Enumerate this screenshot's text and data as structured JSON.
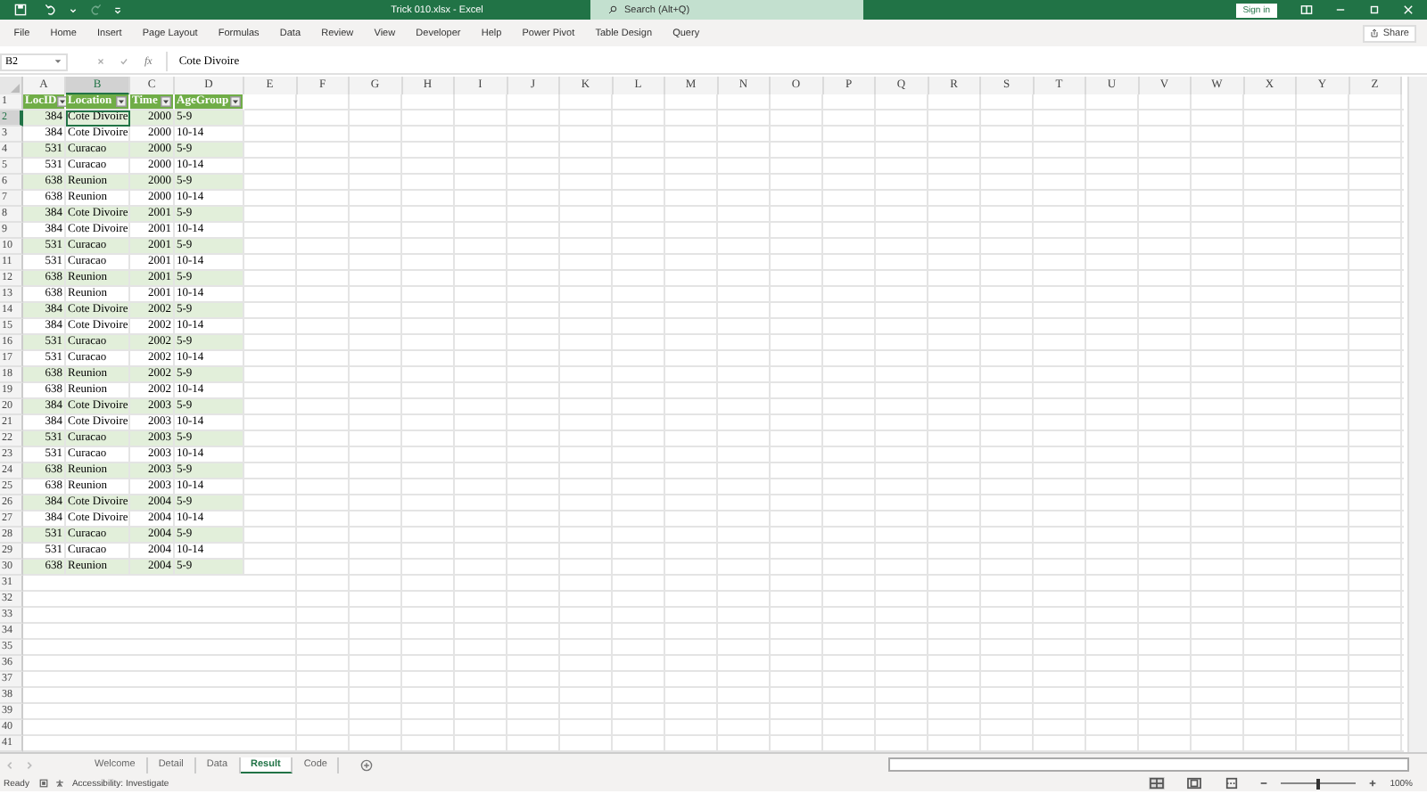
{
  "window": {
    "title": "Trick 010.xlsx  -  Excel",
    "search": {
      "placeholder": "Search (Alt+Q)"
    },
    "sign_in": "Sign in"
  },
  "ribbon": {
    "tabs": [
      "File",
      "Home",
      "Insert",
      "Page Layout",
      "Formulas",
      "Data",
      "Review",
      "View",
      "Developer",
      "Help",
      "Power Pivot",
      "Table Design",
      "Query"
    ],
    "share": "Share"
  },
  "formula_bar": {
    "name_box": "B2",
    "fx_label": "fx",
    "value": "Cote Divoire"
  },
  "grid": {
    "column_letters": [
      {
        "label": "A",
        "selected": false
      },
      {
        "label": "B",
        "selected": true
      },
      {
        "label": "C",
        "selected": false
      },
      {
        "label": "D",
        "selected": false
      },
      {
        "label": "E",
        "selected": false
      },
      {
        "label": "F",
        "selected": false
      },
      {
        "label": "G",
        "selected": false
      },
      {
        "label": "H",
        "selected": false
      },
      {
        "label": "I",
        "selected": false
      },
      {
        "label": "J",
        "selected": false
      },
      {
        "label": "K",
        "selected": false
      },
      {
        "label": "L",
        "selected": false
      },
      {
        "label": "M",
        "selected": false
      },
      {
        "label": "N",
        "selected": false
      },
      {
        "label": "O",
        "selected": false
      },
      {
        "label": "P",
        "selected": false
      },
      {
        "label": "Q",
        "selected": false
      },
      {
        "label": "R",
        "selected": false
      },
      {
        "label": "S",
        "selected": false
      },
      {
        "label": "T",
        "selected": false
      },
      {
        "label": "U",
        "selected": false
      },
      {
        "label": "V",
        "selected": false
      },
      {
        "label": "W",
        "selected": false
      },
      {
        "label": "X",
        "selected": false
      },
      {
        "label": "Y",
        "selected": false
      },
      {
        "label": "Z",
        "selected": false
      }
    ],
    "row_numbers": [
      {
        "label": "1",
        "selected": false
      },
      {
        "label": "2",
        "selected": true
      },
      {
        "label": "3",
        "selected": false
      },
      {
        "label": "4",
        "selected": false
      },
      {
        "label": "5",
        "selected": false
      },
      {
        "label": "6",
        "selected": false
      },
      {
        "label": "7",
        "selected": false
      },
      {
        "label": "8",
        "selected": false
      },
      {
        "label": "9",
        "selected": false
      },
      {
        "label": "10",
        "selected": false
      },
      {
        "label": "11",
        "selected": false
      },
      {
        "label": "12",
        "selected": false
      },
      {
        "label": "13",
        "selected": false
      },
      {
        "label": "14",
        "selected": false
      },
      {
        "label": "15",
        "selected": false
      },
      {
        "label": "16",
        "selected": false
      },
      {
        "label": "17",
        "selected": false
      },
      {
        "label": "18",
        "selected": false
      },
      {
        "label": "19",
        "selected": false
      },
      {
        "label": "20",
        "selected": false
      },
      {
        "label": "21",
        "selected": false
      },
      {
        "label": "22",
        "selected": false
      },
      {
        "label": "23",
        "selected": false
      },
      {
        "label": "24",
        "selected": false
      },
      {
        "label": "25",
        "selected": false
      },
      {
        "label": "26",
        "selected": false
      },
      {
        "label": "27",
        "selected": false
      },
      {
        "label": "28",
        "selected": false
      },
      {
        "label": "29",
        "selected": false
      },
      {
        "label": "30",
        "selected": false
      },
      {
        "label": "31",
        "selected": false
      },
      {
        "label": "32",
        "selected": false
      },
      {
        "label": "33",
        "selected": false
      },
      {
        "label": "34",
        "selected": false
      },
      {
        "label": "35",
        "selected": false
      },
      {
        "label": "36",
        "selected": false
      },
      {
        "label": "37",
        "selected": false
      },
      {
        "label": "38",
        "selected": false
      },
      {
        "label": "39",
        "selected": false
      },
      {
        "label": "40",
        "selected": false
      },
      {
        "label": "41",
        "selected": false
      }
    ]
  },
  "table": {
    "columns": [
      "LocID",
      "Location",
      "Time",
      "AgeGroup"
    ],
    "rows": [
      [
        "384",
        "Cote Divoire",
        "2000",
        "5-9"
      ],
      [
        "384",
        "Cote Divoire",
        "2000",
        "10-14"
      ],
      [
        "531",
        "Curacao",
        "2000",
        "5-9"
      ],
      [
        "531",
        "Curacao",
        "2000",
        "10-14"
      ],
      [
        "638",
        "Reunion",
        "2000",
        "5-9"
      ],
      [
        "638",
        "Reunion",
        "2000",
        "10-14"
      ],
      [
        "384",
        "Cote Divoire",
        "2001",
        "5-9"
      ],
      [
        "384",
        "Cote Divoire",
        "2001",
        "10-14"
      ],
      [
        "531",
        "Curacao",
        "2001",
        "5-9"
      ],
      [
        "531",
        "Curacao",
        "2001",
        "10-14"
      ],
      [
        "638",
        "Reunion",
        "2001",
        "5-9"
      ],
      [
        "638",
        "Reunion",
        "2001",
        "10-14"
      ],
      [
        "384",
        "Cote Divoire",
        "2002",
        "5-9"
      ],
      [
        "384",
        "Cote Divoire",
        "2002",
        "10-14"
      ],
      [
        "531",
        "Curacao",
        "2002",
        "5-9"
      ],
      [
        "531",
        "Curacao",
        "2002",
        "10-14"
      ],
      [
        "638",
        "Reunion",
        "2002",
        "5-9"
      ],
      [
        "638",
        "Reunion",
        "2002",
        "10-14"
      ],
      [
        "384",
        "Cote Divoire",
        "2003",
        "5-9"
      ],
      [
        "384",
        "Cote Divoire",
        "2003",
        "10-14"
      ],
      [
        "531",
        "Curacao",
        "2003",
        "5-9"
      ],
      [
        "531",
        "Curacao",
        "2003",
        "10-14"
      ],
      [
        "638",
        "Reunion",
        "2003",
        "5-9"
      ],
      [
        "638",
        "Reunion",
        "2003",
        "10-14"
      ],
      [
        "384",
        "Cote Divoire",
        "2004",
        "5-9"
      ],
      [
        "384",
        "Cote Divoire",
        "2004",
        "10-14"
      ],
      [
        "531",
        "Curacao",
        "2004",
        "5-9"
      ],
      [
        "531",
        "Curacao",
        "2004",
        "10-14"
      ],
      [
        "638",
        "Reunion",
        "2004",
        "5-9"
      ]
    ]
  },
  "sheet_tabs": [
    {
      "label": "Welcome",
      "selected": false
    },
    {
      "label": "Detail",
      "selected": false
    },
    {
      "label": "Data",
      "selected": false
    },
    {
      "label": "Result",
      "selected": true
    },
    {
      "label": "Code",
      "selected": false
    }
  ],
  "status_bar": {
    "status": "Ready",
    "accessibility": "Accessibility: Investigate",
    "zoom": {
      "level": 0.5,
      "reading": "100%"
    }
  }
}
